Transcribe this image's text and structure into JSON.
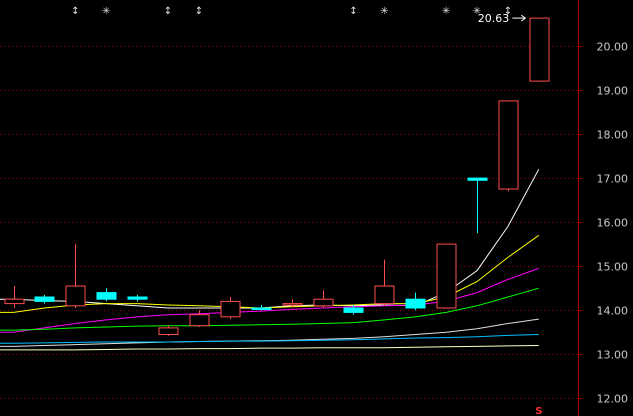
{
  "chart_data": {
    "type": "candlestick",
    "ylim": [
      11.6,
      20.95
    ],
    "yticks": [
      "20.00",
      "19.00",
      "18.00",
      "17.00",
      "16.00",
      "15.00",
      "14.00",
      "13.00",
      "12.00"
    ],
    "grid": true,
    "colors": {
      "background": "#000000",
      "up": "#ff4d4d",
      "down": "#00ffff",
      "grid": "#8b0000",
      "axis": "#b00000"
    },
    "candles": [
      {
        "open": 14.15,
        "close": 14.25,
        "high": 14.55,
        "low": 14.05
      },
      {
        "open": 14.3,
        "close": 14.2,
        "high": 14.35,
        "low": 14.15
      },
      {
        "open": 14.1,
        "close": 14.55,
        "high": 15.5,
        "low": 14.05
      },
      {
        "open": 14.4,
        "close": 14.25,
        "high": 14.5,
        "low": 14.2
      },
      {
        "open": 14.3,
        "close": 14.25,
        "high": 14.35,
        "low": 14.2
      },
      {
        "open": 13.45,
        "close": 13.6,
        "high": 13.65,
        "low": 13.42
      },
      {
        "open": 13.65,
        "close": 13.9,
        "high": 14.0,
        "low": 13.62
      },
      {
        "open": 13.85,
        "close": 14.2,
        "high": 14.3,
        "low": 13.8
      },
      {
        "open": 14.05,
        "close": 14.02,
        "high": 14.12,
        "low": 14.0
      },
      {
        "open": 14.15,
        "close": 14.15,
        "high": 14.25,
        "low": 14.08
      },
      {
        "open": 14.1,
        "close": 14.25,
        "high": 14.45,
        "low": 14.05
      },
      {
        "open": 14.05,
        "close": 13.95,
        "high": 14.12,
        "low": 13.9
      },
      {
        "open": 14.15,
        "close": 14.55,
        "high": 15.15,
        "low": 14.1
      },
      {
        "open": 14.25,
        "close": 14.05,
        "high": 14.4,
        "low": 14.0
      },
      {
        "open": 14.05,
        "close": 15.5,
        "high": 15.5,
        "low": 14.05
      },
      {
        "open": 17.0,
        "close": 16.95,
        "high": 17.0,
        "low": 15.75
      },
      {
        "open": 16.75,
        "close": 18.75,
        "high": 18.75,
        "low": 16.7
      },
      {
        "open": 19.2,
        "close": 20.63,
        "high": 20.63,
        "low": 19.2
      }
    ],
    "moving_averages": [
      {
        "color": "#ffffff",
        "values": [
          14.25,
          14.22,
          14.2,
          14.15,
          14.1,
          14.05,
          14.05,
          14.05,
          14.05,
          14.1,
          14.12,
          14.1,
          14.12,
          14.1,
          14.4,
          14.9,
          15.9,
          17.2
        ]
      },
      {
        "color": "#ffff00",
        "values": [
          13.95,
          14.05,
          14.12,
          14.15,
          14.15,
          14.12,
          14.1,
          14.08,
          14.05,
          14.08,
          14.1,
          14.12,
          14.15,
          14.15,
          14.3,
          14.65,
          15.2,
          15.7
        ]
      },
      {
        "color": "#ff00ff",
        "values": [
          13.5,
          13.6,
          13.7,
          13.78,
          13.85,
          13.9,
          13.92,
          13.95,
          13.98,
          14.02,
          14.05,
          14.08,
          14.1,
          14.12,
          14.2,
          14.4,
          14.7,
          14.95
        ]
      },
      {
        "color": "#00ff00",
        "values": [
          13.55,
          13.57,
          13.6,
          13.62,
          13.64,
          13.65,
          13.65,
          13.66,
          13.67,
          13.68,
          13.7,
          13.72,
          13.78,
          13.85,
          13.95,
          14.1,
          14.3,
          14.5
        ]
      },
      {
        "color": "#e0e0e0",
        "values": [
          13.18,
          13.2,
          13.22,
          13.24,
          13.26,
          13.28,
          13.29,
          13.3,
          13.31,
          13.32,
          13.34,
          13.36,
          13.4,
          13.45,
          13.5,
          13.58,
          13.7,
          13.8
        ]
      },
      {
        "color": "#00bfff",
        "values": [
          13.25,
          13.26,
          13.27,
          13.28,
          13.28,
          13.28,
          13.29,
          13.3,
          13.3,
          13.31,
          13.32,
          13.33,
          13.35,
          13.37,
          13.38,
          13.4,
          13.43,
          13.45
        ]
      },
      {
        "color": "#ffffc0",
        "values": [
          13.1,
          13.1,
          13.1,
          13.11,
          13.12,
          13.12,
          13.13,
          13.13,
          13.14,
          13.14,
          13.15,
          13.15,
          13.15,
          13.16,
          13.17,
          13.18,
          13.19,
          13.2
        ]
      }
    ],
    "annotations": {
      "high_label": "20.63",
      "top_markers": [
        "↕",
        "✳",
        "↕",
        "↕",
        "↕",
        "✳",
        "✳",
        "✳",
        "↕"
      ],
      "top_marker_candles": [
        2,
        3,
        5,
        6,
        11,
        12,
        14,
        15,
        16
      ],
      "bottom_marker": "S",
      "bottom_marker_candle": 17
    }
  }
}
